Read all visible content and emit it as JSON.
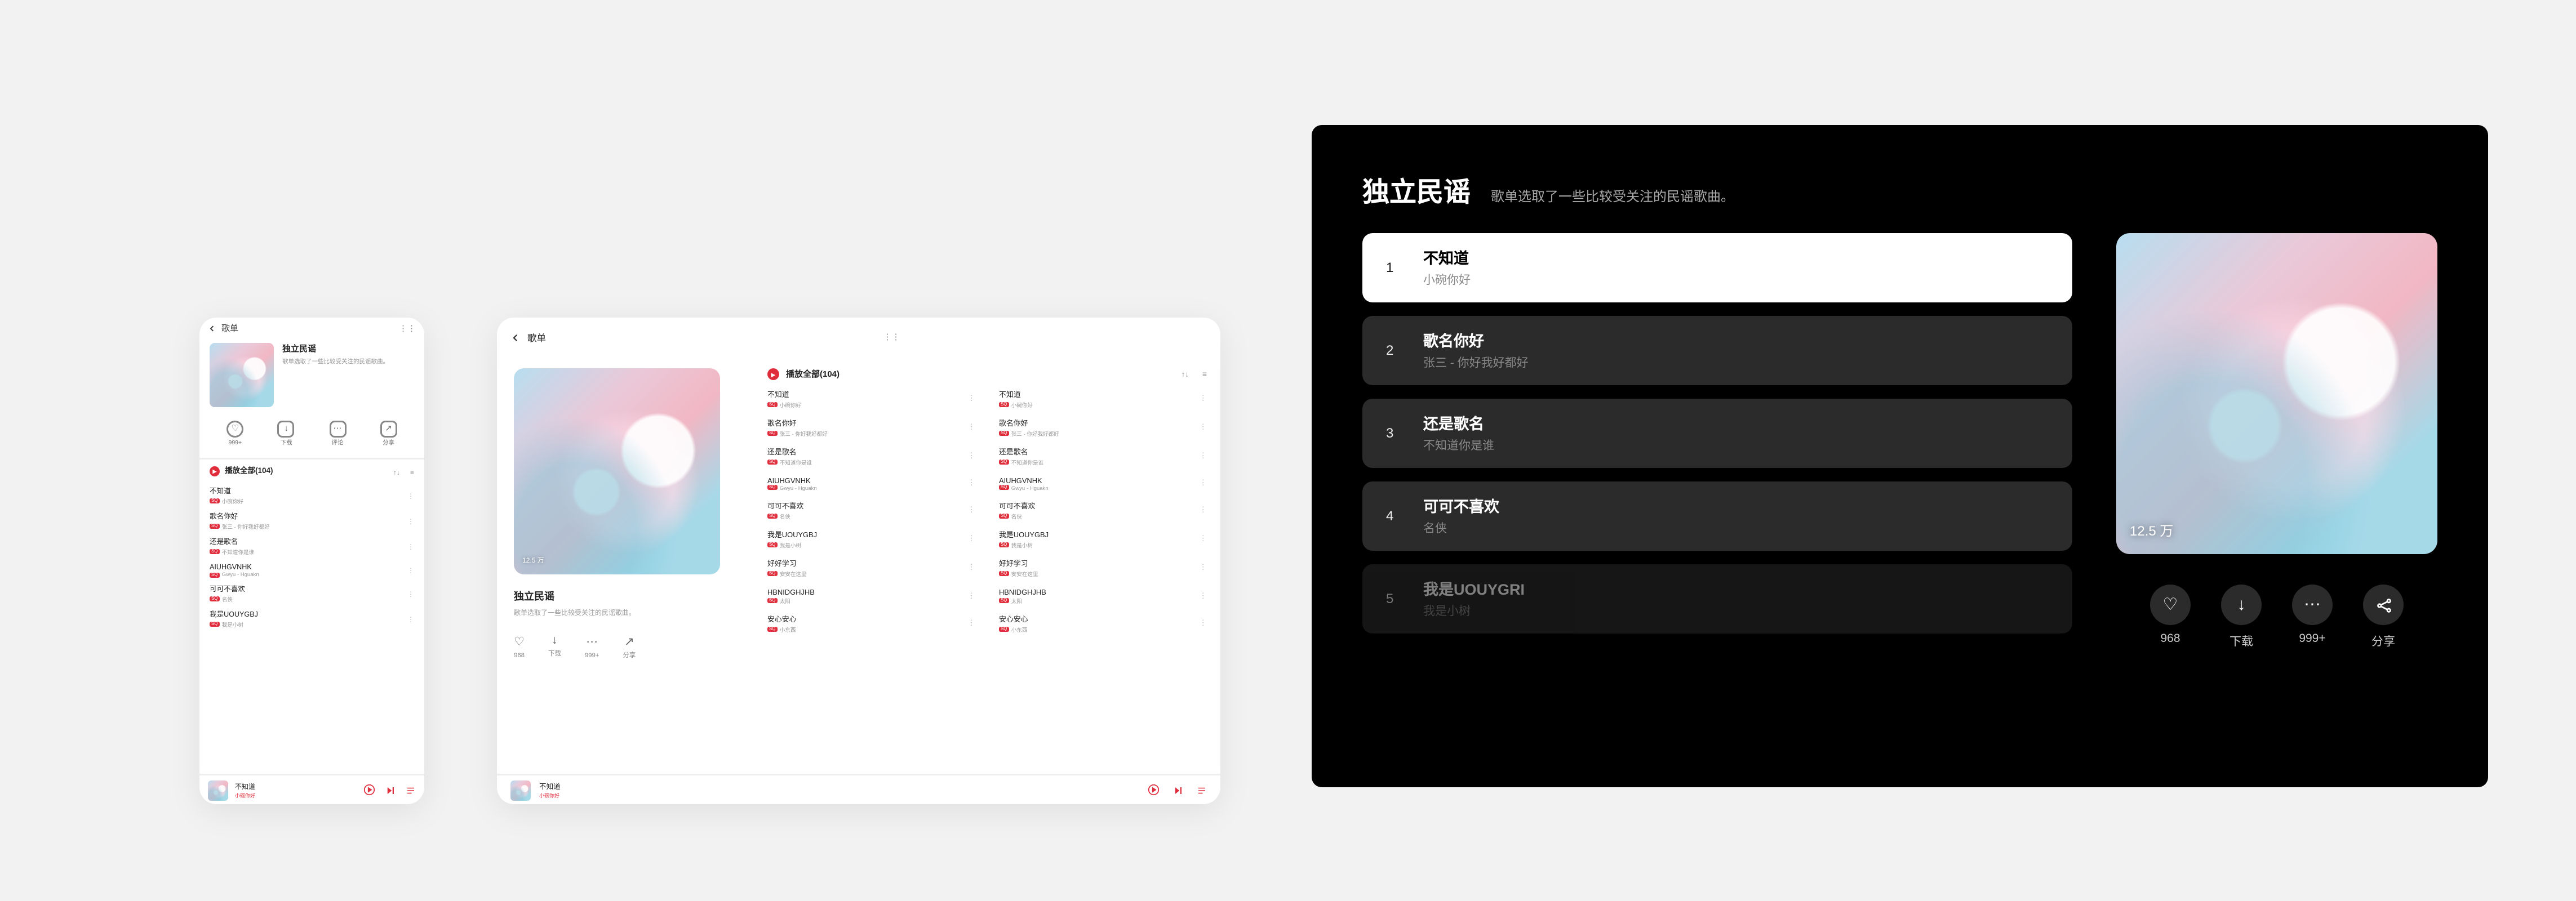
{
  "playlist": {
    "nav_title": "歌单",
    "name": "独立民谣",
    "desc_short": "歌单选取了一些比较受关注的民谣歌曲。",
    "desc_long": "歌单选取了一些比较受关注的民谣歌曲。",
    "play_count": "12.5 万",
    "count": 104,
    "play_all_label": "播放全部(104)",
    "quality_badge": "SQ"
  },
  "actions": {
    "like": {
      "label_phone": "999+",
      "label_tablet": "968",
      "label_tv": "968"
    },
    "download": {
      "label": "下载"
    },
    "comment": {
      "label_phone": "评论",
      "label_tablet": "999+",
      "label_tv": "999+"
    },
    "share": {
      "label": "分享"
    }
  },
  "now_playing": {
    "title": "不知道",
    "artist": "小碗你好"
  },
  "songs": [
    {
      "name": "不知道",
      "artist": "小碗你好"
    },
    {
      "name": "歌名你好",
      "artist": "张三 - 你好我好都好"
    },
    {
      "name": "还是歌名",
      "artist": "不知道你是谁"
    },
    {
      "name": "AIUHGVNHK",
      "artist": "Gwyu - Hguakn"
    },
    {
      "name": "可可不喜欢",
      "artist": "名侠"
    },
    {
      "name": "我是UOUYGBJ",
      "artist": "我是小树"
    },
    {
      "name": "好好学习",
      "artist": "安安在这里"
    },
    {
      "name": "HBNIDGHJHB",
      "artist": "太阳"
    },
    {
      "name": "安心安心",
      "artist": "小东西"
    }
  ],
  "tablet_cols": {
    "col_b": [
      {
        "name": "不知道",
        "artist": "小碗你好"
      },
      {
        "name": "歌名你好",
        "artist": "张三 - 你好我好都好"
      },
      {
        "name": "还是歌名",
        "artist": "不知道你是谁"
      },
      {
        "name": "AIUHGVNHK",
        "artist": "Gwyu - Hguakn"
      },
      {
        "name": "可可不喜欢",
        "artist": "名侠"
      },
      {
        "name": "我是UOUYGBJ",
        "artist": "我是小树"
      },
      {
        "name": "好好学习",
        "artist": "安安在这里"
      },
      {
        "name": "HBNIDGHJHB",
        "artist": "太阳"
      },
      {
        "name": "安心安心",
        "artist": "小东西"
      }
    ]
  },
  "tv_songs": [
    {
      "name": "不知道",
      "artist": "小碗你好"
    },
    {
      "name": "歌名你好",
      "artist": "张三 - 你好我好都好"
    },
    {
      "name": "还是歌名",
      "artist": "不知道你是谁"
    },
    {
      "name": "可可不喜欢",
      "artist": "名侠"
    },
    {
      "name": "我是UOUYGRI",
      "artist": "我是小树"
    }
  ],
  "colors": {
    "accent": "#e02d3c",
    "bg": "#f2f2f2",
    "tv_bg": "#000000",
    "tv_row": "#2b2b2b"
  }
}
